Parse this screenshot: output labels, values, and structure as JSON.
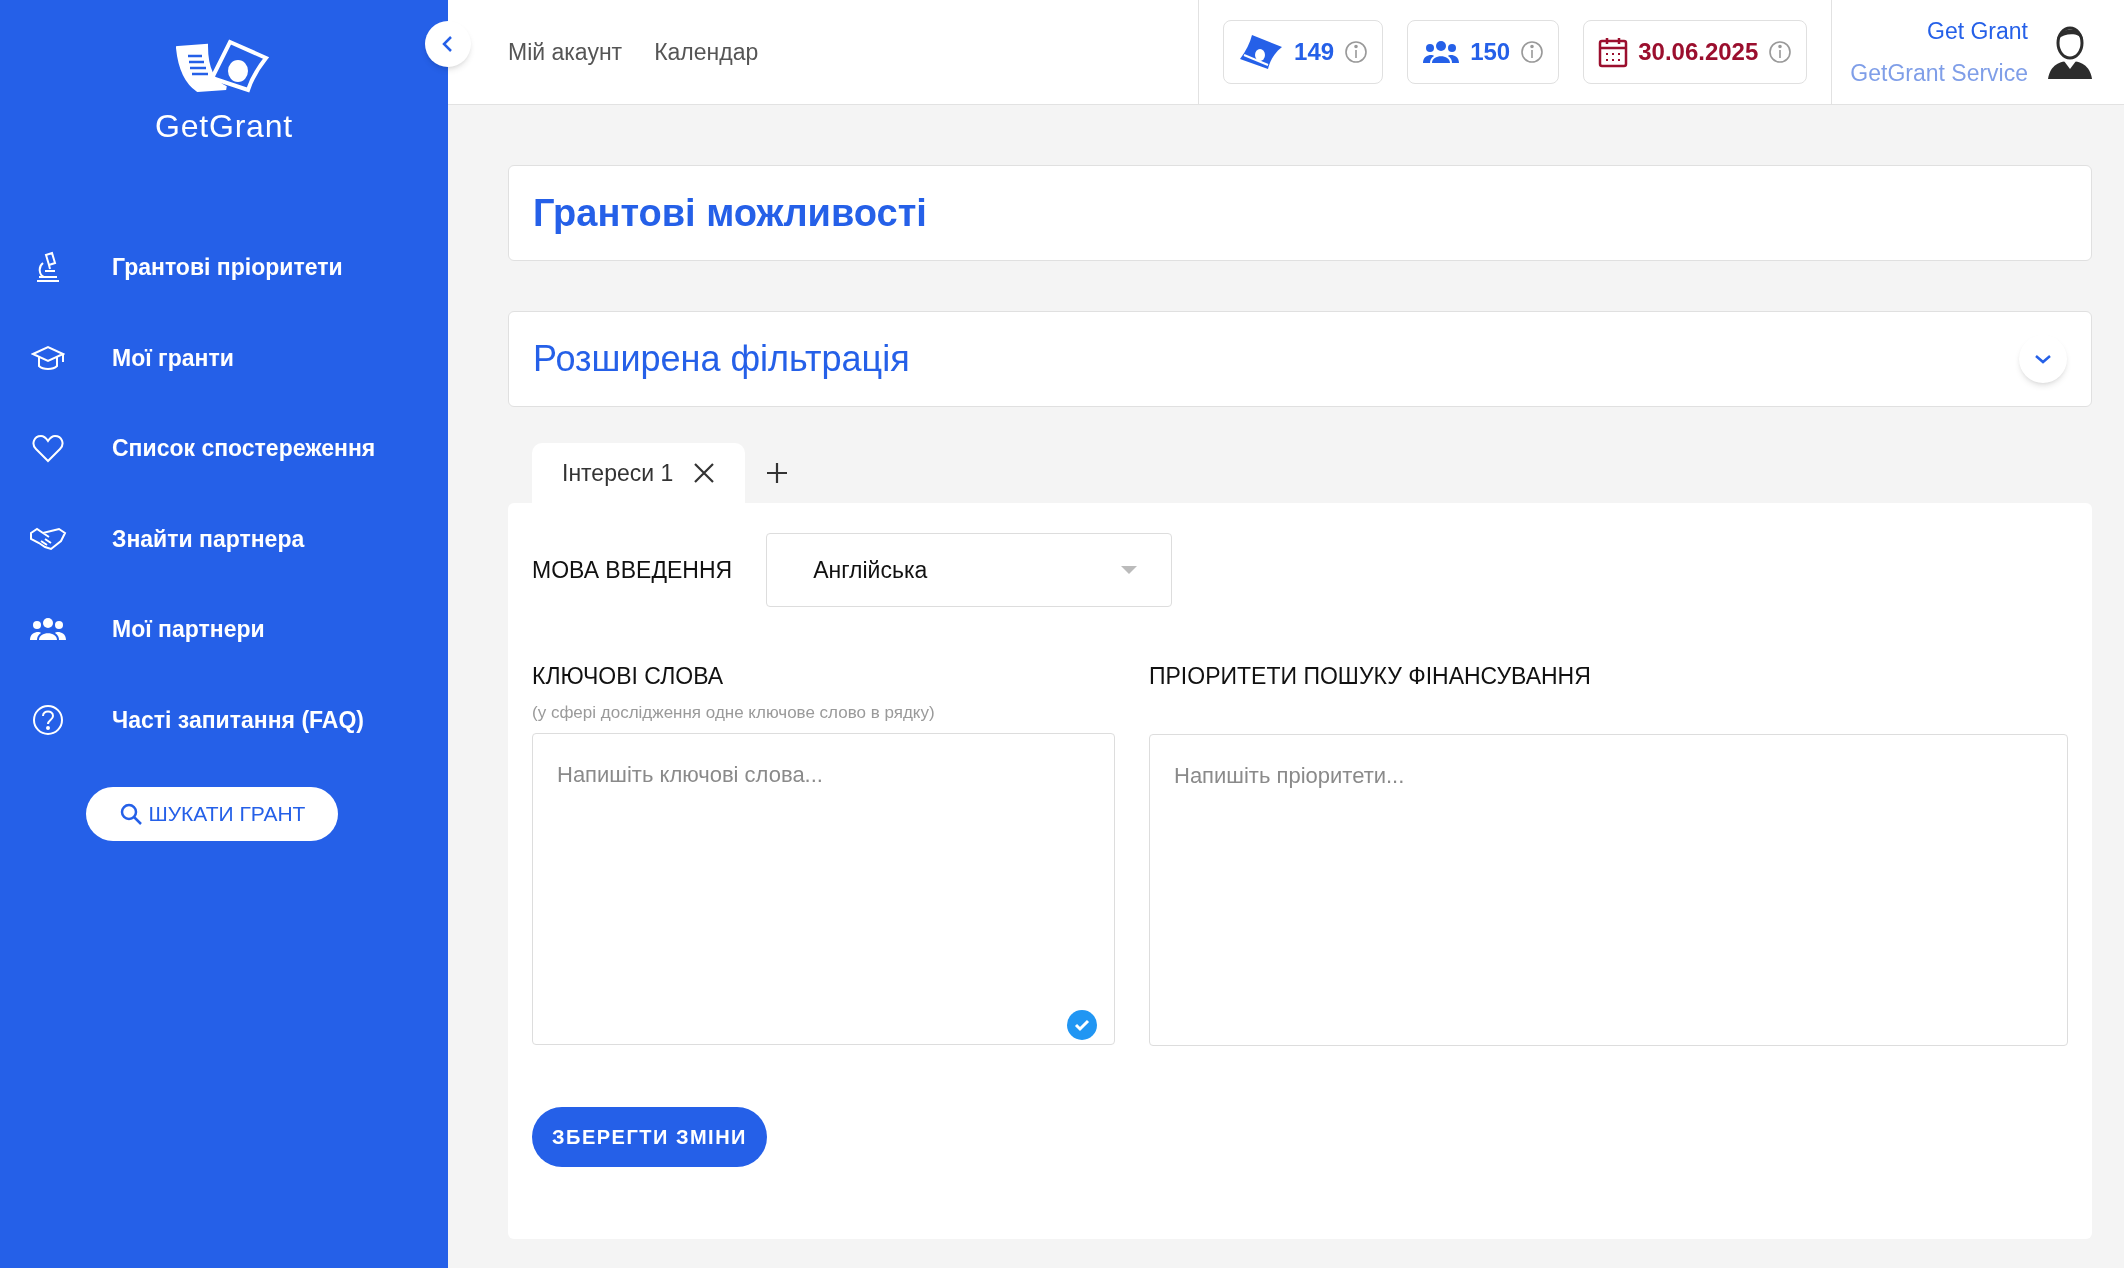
{
  "sidebar": {
    "logo": "GetGrant",
    "items": [
      {
        "kind": "microscope",
        "label": "Грантові пріоритети"
      },
      {
        "kind": "cap",
        "label": "Мої гранти"
      },
      {
        "kind": "heart",
        "label": "Список спостереження"
      },
      {
        "kind": "handshake",
        "label": "Знайти партнера"
      },
      {
        "kind": "people",
        "label": "Мої партнери"
      },
      {
        "kind": "question",
        "label": "Часті запитання (FAQ)"
      }
    ],
    "search_button": "ШУКАТИ ГРАНТ"
  },
  "header": {
    "nav": [
      "Мій акаунт",
      "Календар"
    ],
    "badges": [
      {
        "kind": "money",
        "value": "149"
      },
      {
        "kind": "people",
        "value": "150"
      },
      {
        "kind": "calendar",
        "value": "30.06.2025"
      }
    ],
    "user": {
      "name": "Get Grant",
      "org": "GetGrant Service"
    }
  },
  "page_title": "Грантові можливості",
  "filter": {
    "title": "Розширена фільтрація",
    "expanded": false
  },
  "tabs": [
    {
      "label": "Інтереси 1",
      "selected": true
    }
  ],
  "form": {
    "language": {
      "label": "МОВА ВВЕДЕННЯ",
      "value": "Англійська"
    },
    "keywords": {
      "label": "КЛЮЧОВІ СЛОВА",
      "hint": "(у сфері дослідження одне ключове слово в рядку)",
      "placeholder": "Напишіть ключові слова...",
      "valid": true
    },
    "priorities": {
      "label": "ПРІОРИТЕТИ ПОШУКУ ФІНАНСУВАННЯ",
      "placeholder": "Напишіть пріоритети..."
    },
    "save_button": "ЗБЕРЕГТИ ЗМІНИ"
  }
}
